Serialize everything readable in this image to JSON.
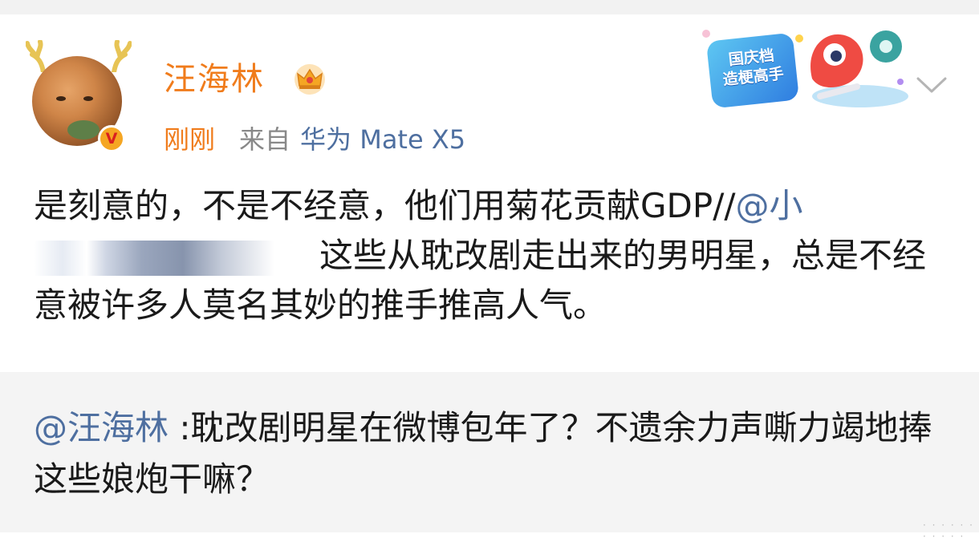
{
  "post": {
    "username": "汪海林",
    "time": "刚刚",
    "source_prefix": "来自",
    "device": "华为 Mate X5",
    "promo_badge_line1": "国庆档",
    "promo_badge_line2": "造梗高手",
    "verified_badge": "V",
    "content_part1": "是刻意的，不是不经意，他们用菊花贡献GDP//",
    "content_mention": "@小",
    "content_part2": "这些从耽改剧走出来的男明星，总是不经意被许多人莫名其妙的推手推高人气。"
  },
  "quote": {
    "mention": "@汪海林",
    "text": ":耽改剧明星在微博包年了？不遗余力声嘶力竭地捧这些娘炮干嘛？"
  },
  "colors": {
    "username": "#f07c1c",
    "link": "#4e6fa0",
    "quote_bg": "#f4f4f4"
  },
  "icons": {
    "crown": "crown-icon",
    "chevron": "chevron-down-icon",
    "verified": "verified-badge-icon"
  }
}
